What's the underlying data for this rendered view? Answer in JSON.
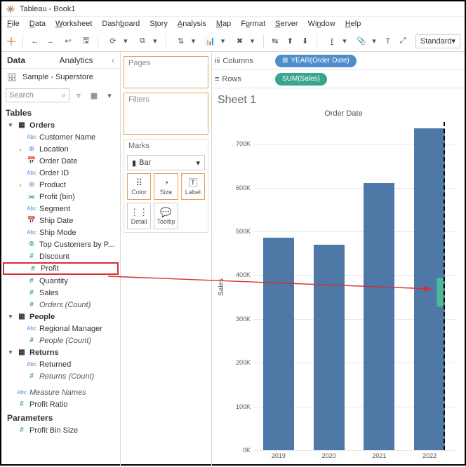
{
  "window": {
    "title": "Tableau - Book1"
  },
  "menu": [
    "File",
    "Data",
    "Worksheet",
    "Dashboard",
    "Story",
    "Analysis",
    "Map",
    "Format",
    "Server",
    "Window",
    "Help"
  ],
  "toolbar": {
    "fit_mode": "Standard"
  },
  "side_tabs": {
    "data": "Data",
    "analytics": "Analytics"
  },
  "datasource": {
    "name": "Sample - Superstore"
  },
  "search": {
    "placeholder": "Search"
  },
  "sections": {
    "tables": "Tables",
    "parameters": "Parameters"
  },
  "tree": {
    "orders": {
      "label": "Orders",
      "fields": [
        {
          "icon": "abc",
          "label": "Customer Name"
        },
        {
          "icon": "geo",
          "label": "Location",
          "expand": true
        },
        {
          "icon": "dt",
          "label": "Order Date"
        },
        {
          "icon": "abc",
          "label": "Order ID"
        },
        {
          "icon": "geo",
          "label": "Product",
          "expand": true
        },
        {
          "icon": "bar",
          "label": "Profit (bin)"
        },
        {
          "icon": "abc",
          "label": "Segment"
        },
        {
          "icon": "dt",
          "label": "Ship Date"
        },
        {
          "icon": "abc",
          "label": "Ship Mode"
        },
        {
          "icon": "set",
          "label": "Top Customers by P..."
        },
        {
          "icon": "num",
          "label": "Discount"
        },
        {
          "icon": "num",
          "label": "Profit",
          "hl": true
        },
        {
          "icon": "num",
          "label": "Quantity"
        },
        {
          "icon": "num",
          "label": "Sales"
        },
        {
          "icon": "num",
          "label": "Orders (Count)",
          "italic": true
        }
      ]
    },
    "people": {
      "label": "People",
      "fields": [
        {
          "icon": "abc",
          "label": "Regional Manager"
        },
        {
          "icon": "num",
          "label": "People (Count)",
          "italic": true
        }
      ]
    },
    "returns": {
      "label": "Returns",
      "fields": [
        {
          "icon": "abc",
          "label": "Returned"
        },
        {
          "icon": "num",
          "label": "Returns (Count)",
          "italic": true
        }
      ]
    },
    "extra": [
      {
        "icon": "abc",
        "label": "Measure Names",
        "italic": true
      },
      {
        "icon": "num",
        "label": "Profit Ratio",
        "italic": false
      }
    ],
    "parameters": [
      {
        "icon": "num",
        "label": "Profit Bin Size"
      }
    ]
  },
  "shelves": {
    "pages": "Pages",
    "filters": "Filters",
    "marks": "Marks",
    "mark_type": "Bar",
    "cells": [
      "Color",
      "Size",
      "Label",
      "Detail",
      "Tooltip"
    ]
  },
  "rowcol": {
    "columns_label": "Columns",
    "rows_label": "Rows",
    "columns_pill": "YEAR(Order Date)",
    "rows_pill": "SUM(Sales)"
  },
  "sheet": {
    "title": "Sheet 1"
  },
  "chart_data": {
    "type": "bar",
    "title": "Order Date",
    "ylabel": "Sales",
    "xlabel": "",
    "categories": [
      "2019",
      "2020",
      "2021",
      "2022"
    ],
    "values": [
      485000,
      470000,
      610000,
      735000
    ],
    "ylim": [
      0,
      750000
    ],
    "yticks": [
      0,
      100000,
      200000,
      300000,
      400000,
      500000,
      600000,
      700000
    ],
    "ytick_labels": [
      "0K",
      "100K",
      "200K",
      "300K",
      "400K",
      "500K",
      "600K",
      "700K"
    ]
  }
}
